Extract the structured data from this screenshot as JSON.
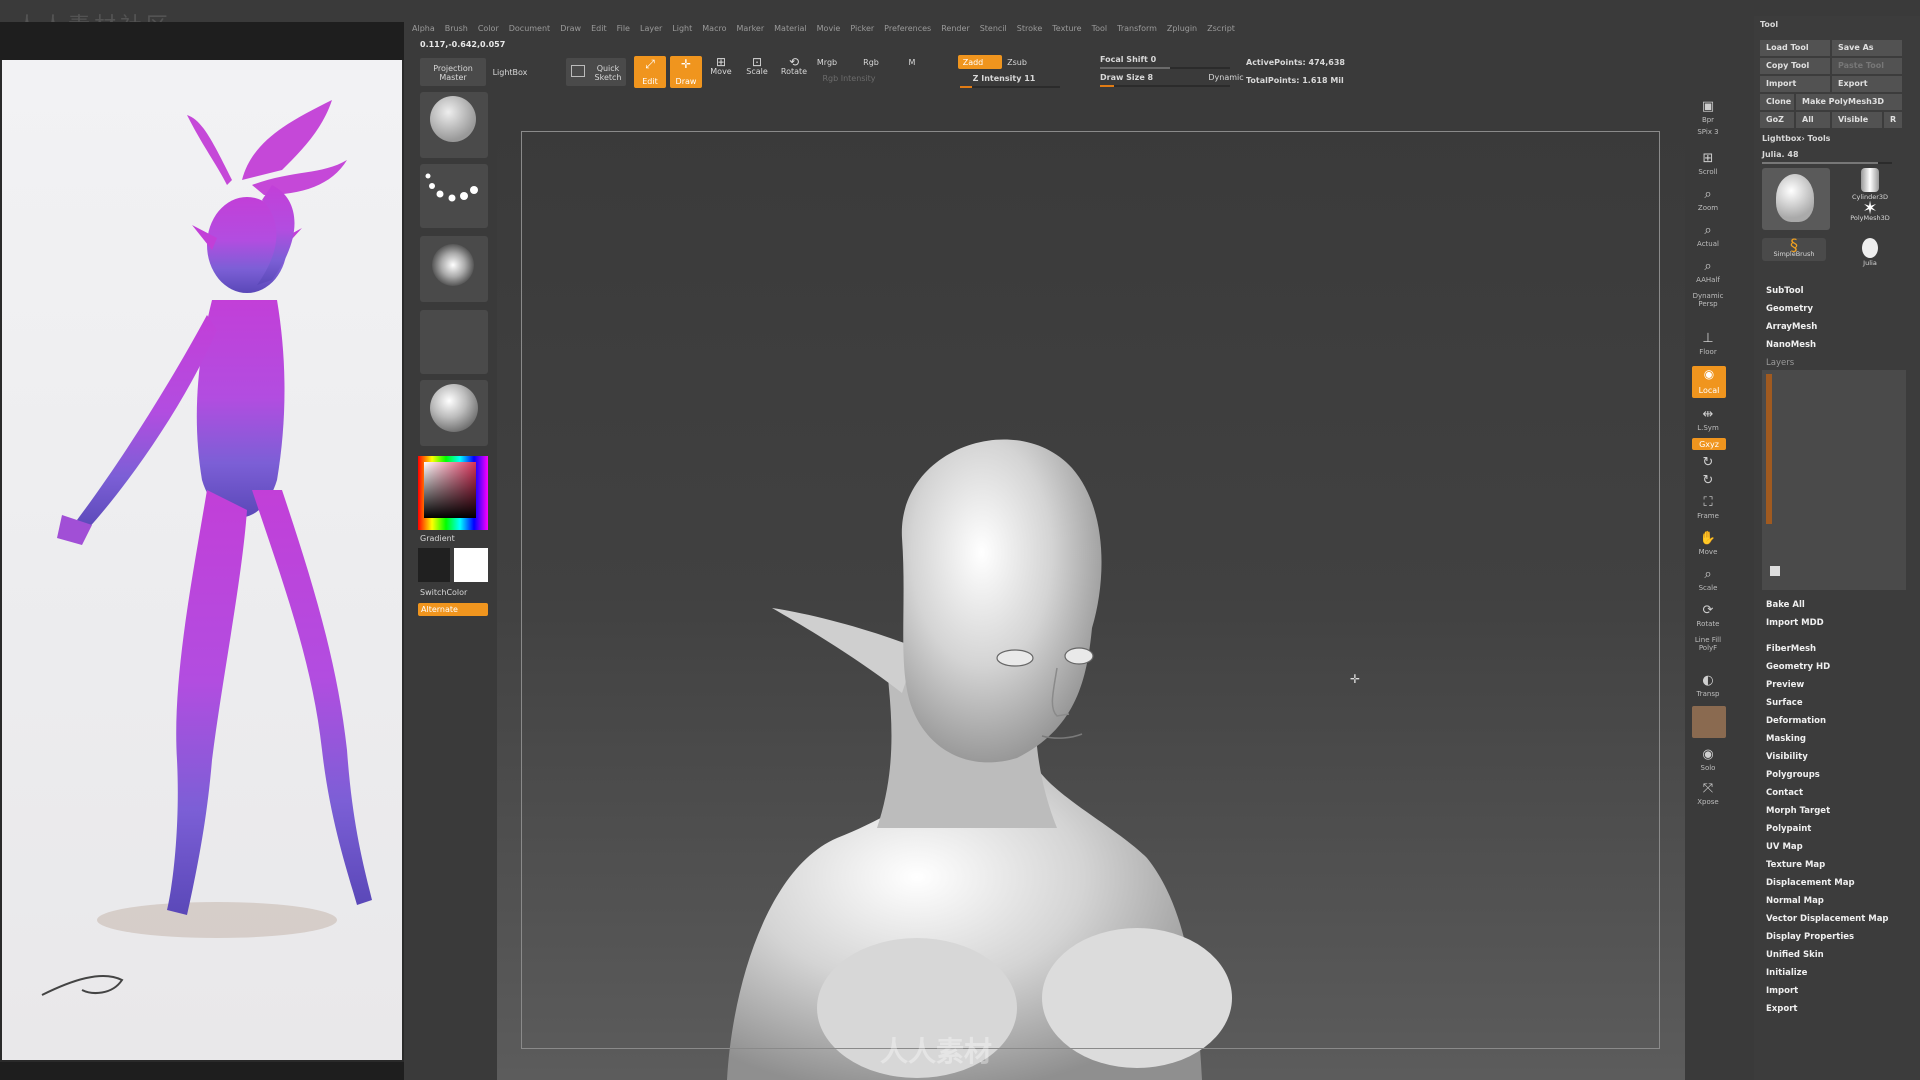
{
  "watermark": "人人素材社区",
  "bottom_watermark": "人人素材",
  "menu": [
    "Alpha",
    "Brush",
    "Color",
    "Document",
    "Draw",
    "Edit",
    "File",
    "Layer",
    "Light",
    "Macro",
    "Marker",
    "Material",
    "Movie",
    "Picker",
    "Preferences",
    "Render",
    "Stencil",
    "Stroke",
    "Texture",
    "Tool",
    "Transform",
    "Zplugin",
    "Zscript"
  ],
  "coords": "0.117,-0.642,0.057",
  "toolbar": {
    "projection_master": "Projection Master",
    "lightbox": "LightBox",
    "quick_sketch": "Quick Sketch",
    "edit": "Edit",
    "draw": "Draw",
    "move": "Move",
    "scale": "Scale",
    "rotate": "Rotate",
    "mrgb": "Mrgb",
    "rgb": "Rgb",
    "m": "M",
    "rgb_intensity": "Rgb Intensity",
    "zadd": "Zadd",
    "zsub": "Zsub",
    "z_intensity": "Z Intensity 11",
    "focal_shift": "Focal Shift 0",
    "draw_size": "Draw Size 8",
    "dynamic": "Dynamic",
    "active_points": "ActivePoints: 474,638",
    "total_points": "TotalPoints: 1.618 Mil",
    "colors": {
      "accent": "#f0951e"
    }
  },
  "left_panel": {
    "gradient": "Gradient",
    "switch_color": "SwitchColor",
    "alternate": "Alternate"
  },
  "right_icons": [
    "Bpr",
    "SPix 3",
    "Scroll",
    "Zoom",
    "Actual",
    "AAHalf",
    "Dynamic Persp",
    "Floor",
    "Local",
    "L.Sym",
    "Gxyz",
    "",
    "",
    "Frame",
    "Move",
    "Scale",
    "Rotate",
    "Line Fill PolyF",
    "Transp",
    "",
    "Solo",
    "Xpose"
  ],
  "tool_palette": {
    "title": "Tool",
    "load_tool": "Load Tool",
    "save_as": "Save As",
    "copy_tool": "Copy Tool",
    "paste_tool": "Paste Tool",
    "import": "Import",
    "export": "Export",
    "clone": "Clone",
    "make_polymesh": "Make PolyMesh3D",
    "goz": "GoZ",
    "all": "All",
    "visible": "Visible",
    "r": "R",
    "lightbox_tools": "Lightbox› Tools",
    "current_tool": "Julia. 48",
    "thumbs": [
      "Cylinder3D",
      "PolyMesh3D",
      "SimpleBrush",
      "Julia"
    ],
    "sections": [
      "SubTool",
      "Geometry",
      "ArrayMesh",
      "NanoMesh",
      "Layers"
    ],
    "bake_all": "Bake All",
    "import_mdd": "Import MDD",
    "sections2": [
      "FiberMesh",
      "Geometry HD",
      "Preview",
      "Surface",
      "Deformation",
      "Masking",
      "Visibility",
      "Polygroups",
      "Contact",
      "Morph Target",
      "Polypaint",
      "UV Map",
      "Texture Map",
      "Displacement Map",
      "Normal Map",
      "Vector Displacement Map",
      "Display Properties",
      "Unified Skin",
      "Initialize",
      "Import",
      "Export"
    ]
  }
}
